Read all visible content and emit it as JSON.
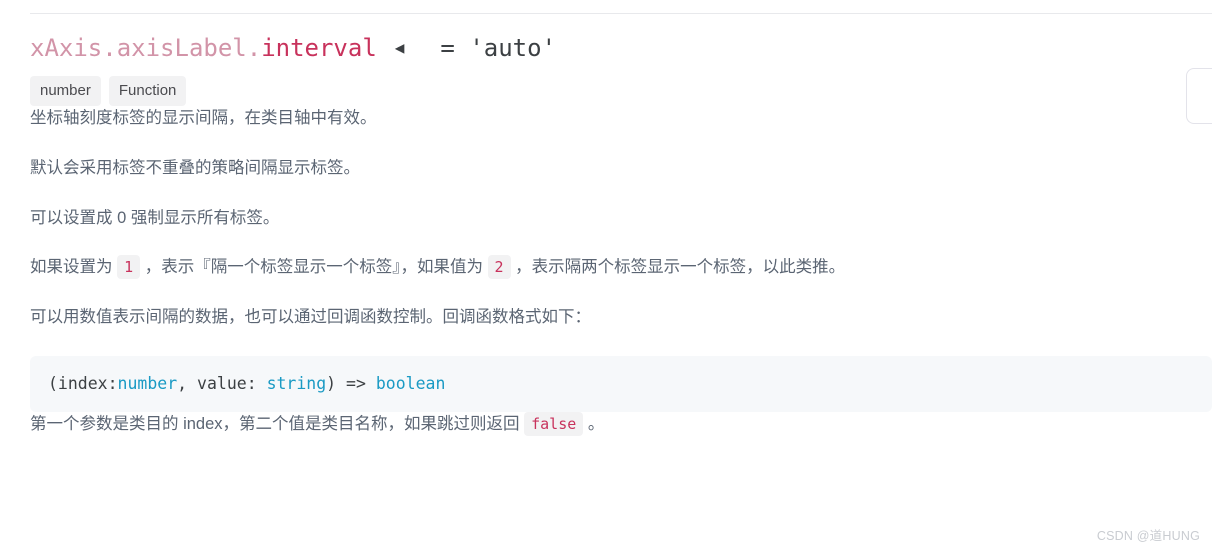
{
  "heading": {
    "prefix": "xAxis.axisLabel.",
    "name": "interval",
    "collapse_icon": "◀",
    "assignment": "= 'auto'"
  },
  "type_badges": [
    {
      "label": "number"
    },
    {
      "label": "Function"
    }
  ],
  "paragraphs": [
    {
      "id": "p1",
      "segments": [
        {
          "kind": "text",
          "text": "坐标轴刻度标签的显示间隔，在类目轴中有效。"
        }
      ]
    },
    {
      "id": "p2",
      "segments": [
        {
          "kind": "text",
          "text": "默认会采用标签不重叠的策略间隔显示标签。"
        }
      ]
    },
    {
      "id": "p3",
      "segments": [
        {
          "kind": "text",
          "text": "可以设置成 0 强制显示所有标签。"
        }
      ]
    },
    {
      "id": "p4",
      "segments": [
        {
          "kind": "text",
          "text": "如果设置为 "
        },
        {
          "kind": "code",
          "text": "1"
        },
        {
          "kind": "text",
          "text": " ，表示『隔一个标签显示一个标签』，如果值为 "
        },
        {
          "kind": "code",
          "text": "2"
        },
        {
          "kind": "text",
          "text": " ，表示隔两个标签显示一个标签，以此类推。"
        }
      ]
    },
    {
      "id": "p5",
      "segments": [
        {
          "kind": "text",
          "text": "可以用数值表示间隔的数据，也可以通过回调函数控制。回调函数格式如下："
        }
      ]
    }
  ],
  "code_block": {
    "tokens": [
      {
        "kind": "plain",
        "text": "(index:"
      },
      {
        "kind": "type",
        "text": "number"
      },
      {
        "kind": "plain",
        "text": ", value: "
      },
      {
        "kind": "type",
        "text": "string"
      },
      {
        "kind": "plain",
        "text": ") => "
      },
      {
        "kind": "type",
        "text": "boolean"
      }
    ]
  },
  "final_paragraph": {
    "id": "p6",
    "segments": [
      {
        "kind": "text",
        "text": "第一个参数是类目的 index，第二个值是类目名称，如果跳过则返回 "
      },
      {
        "kind": "code",
        "text": "false"
      },
      {
        "kind": "text",
        "text": " 。"
      }
    ]
  },
  "watermark": {
    "text": "CSDN @道HUNG"
  },
  "colors": {
    "option_prefix": "#d294a8",
    "option_name": "#c8325c",
    "body_text": "#5b6573",
    "inline_code_text": "#c8325c",
    "inline_code_bg": "#f2f2f3",
    "badge_bg": "#f2f2f3",
    "code_block_bg": "#f6f8fa",
    "code_type_token": "#1a9ac4",
    "watermark": "#c9ccd1"
  }
}
